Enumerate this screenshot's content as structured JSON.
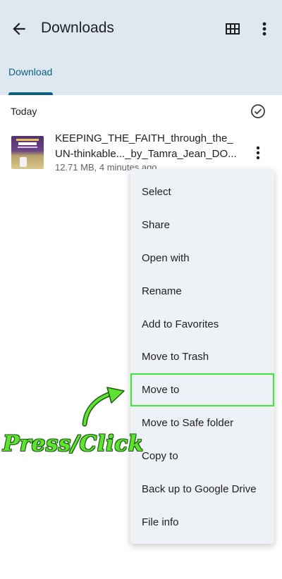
{
  "header": {
    "title": "Downloads",
    "icons": [
      "back-arrow-icon",
      "grid-view-icon",
      "more-vert-icon"
    ]
  },
  "tabs": [
    {
      "label": "Download",
      "selected": true
    }
  ],
  "section": {
    "label": "Today",
    "icon": "check-circle-icon"
  },
  "file": {
    "name": "KEEPING_THE_FAITH_through_the_UN-thinkable..._by_Tamra_Jean_DO...",
    "meta": "12.71 MB, 4 minutes ago"
  },
  "menu": {
    "items": [
      {
        "label": "Select"
      },
      {
        "label": "Share"
      },
      {
        "label": "Open with"
      },
      {
        "label": "Rename"
      },
      {
        "label": "Add to Favorites"
      },
      {
        "label": "Move to Trash"
      },
      {
        "label": "Move to",
        "highlighted": true
      },
      {
        "label": "Move to Safe folder"
      },
      {
        "label": "Copy to"
      },
      {
        "label": "Back up to Google Drive"
      },
      {
        "label": "File info"
      }
    ]
  },
  "annotation": {
    "text": "Press/Click",
    "color": "#5fe12f"
  },
  "colors": {
    "appbar": "#dde8f1",
    "accent": "#0b5f83",
    "menu_bg": "#eef1f6",
    "highlight": "#3de839"
  }
}
